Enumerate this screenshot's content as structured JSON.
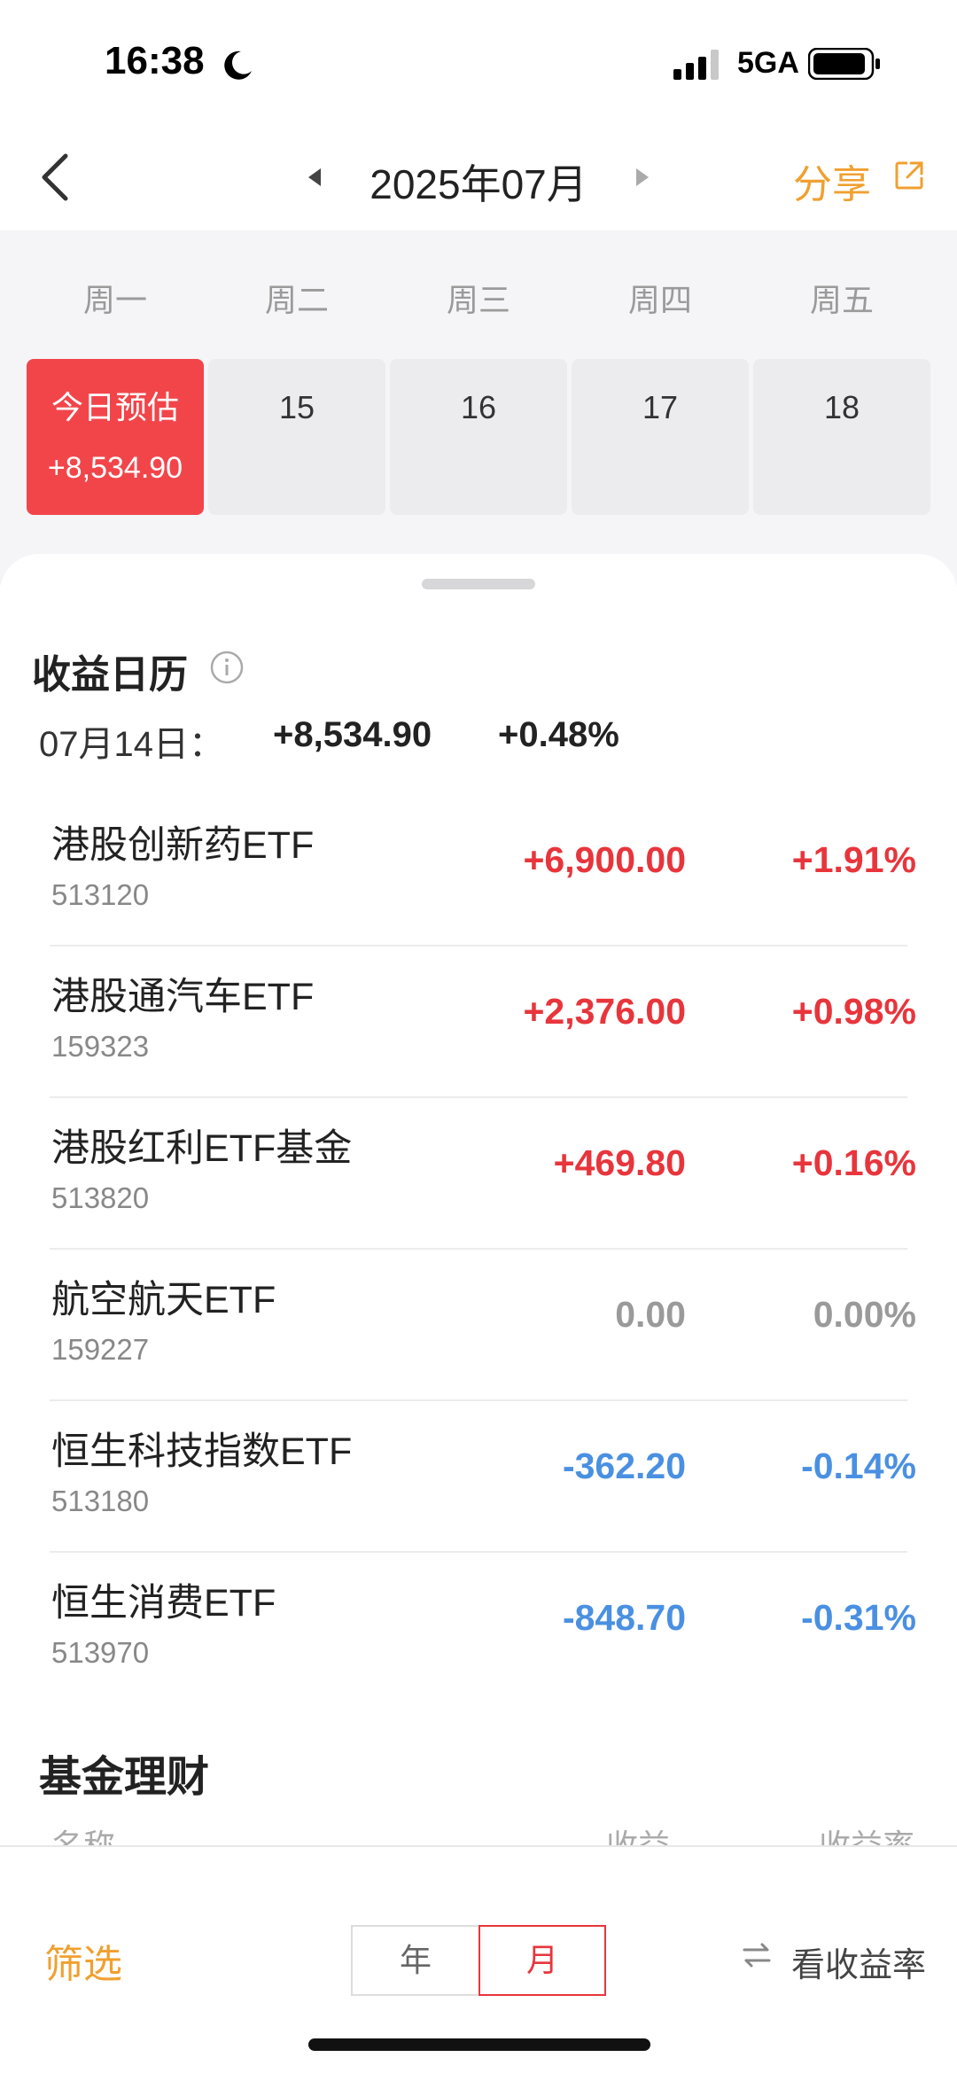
{
  "status_bar": {
    "time": "16:38",
    "network": "5GA"
  },
  "nav": {
    "title": "2025年07月",
    "share_label": "分享"
  },
  "calendar": {
    "weekdays": [
      "周一",
      "周二",
      "周三",
      "周四",
      "周五"
    ],
    "today": {
      "label": "今日预估",
      "value": "+8,534.90"
    },
    "days": [
      "15",
      "16",
      "17",
      "18"
    ]
  },
  "earnings": {
    "title": "收益日历",
    "date": "07月14日：",
    "total_value": "+8,534.90",
    "total_pct": "+0.48%",
    "funds": [
      {
        "name": "港股创新药ETF",
        "code": "513120",
        "value": "+6,900.00",
        "pct": "+1.91%",
        "trend": "pos"
      },
      {
        "name": "港股通汽车ETF",
        "code": "159323",
        "value": "+2,376.00",
        "pct": "+0.98%",
        "trend": "pos"
      },
      {
        "name": "港股红利ETF基金",
        "code": "513820",
        "value": "+469.80",
        "pct": "+0.16%",
        "trend": "pos"
      },
      {
        "name": "航空航天ETF",
        "code": "159227",
        "value": "0.00",
        "pct": "0.00%",
        "trend": "zero"
      },
      {
        "name": "恒生科技指数ETF",
        "code": "513180",
        "value": "-362.20",
        "pct": "-0.14%",
        "trend": "neg"
      },
      {
        "name": "恒生消费ETF",
        "code": "513970",
        "value": "-848.70",
        "pct": "-0.31%",
        "trend": "neg"
      }
    ]
  },
  "fund_section": {
    "title": "基金理财",
    "headers": [
      "名称",
      "收益",
      "收益率"
    ]
  },
  "toolbar": {
    "filter_label": "筛选",
    "year_label": "年",
    "month_label": "月",
    "view_rate_label": "看收益率"
  },
  "colors": {
    "accent": "#f0a030",
    "positive": "#e8353c",
    "negative": "#4a90e2",
    "today_bg": "#f2454a"
  }
}
